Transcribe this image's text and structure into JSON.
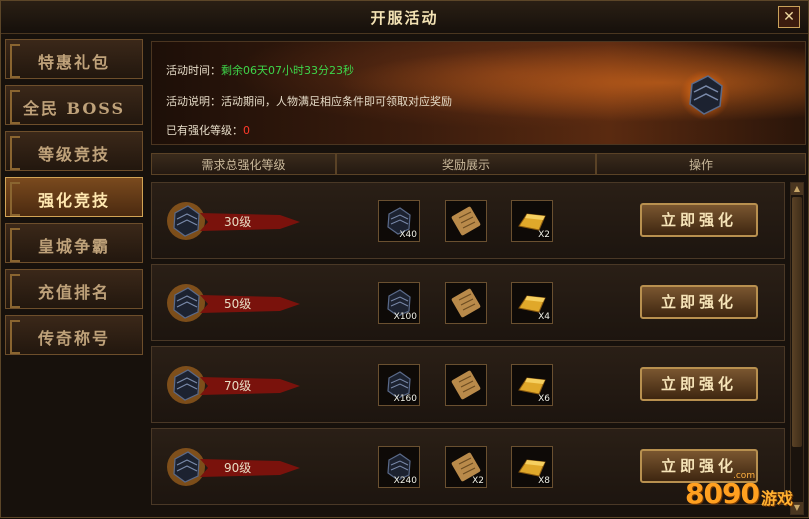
{
  "window": {
    "title": "开服活动",
    "close_symbol": "✕"
  },
  "sidebar": {
    "items": [
      {
        "label": "特惠礼包",
        "active": false
      },
      {
        "label": "全民 BOSS",
        "active": false
      },
      {
        "label": "等级竞技",
        "active": false
      },
      {
        "label": "强化竞技",
        "active": true
      },
      {
        "label": "皇城争霸",
        "active": false
      },
      {
        "label": "充值排名",
        "active": false
      },
      {
        "label": "传奇称号",
        "active": false
      }
    ]
  },
  "banner": {
    "time_label": "活动时间：",
    "time_value": "剩余06天07小时33分23秒",
    "desc_label": "活动说明：",
    "desc_value": "活动期间，人物满足相应条件即可领取对应奖励",
    "owned_label": "已有强化等级：",
    "owned_value": "0",
    "icon": "black-iron-ore-icon"
  },
  "table": {
    "headers": [
      "需求总强化等级",
      "奖励展示",
      "操作"
    ],
    "rows": [
      {
        "level": "30级",
        "rewards": [
          {
            "icon": "ore-icon",
            "qty": "X40"
          },
          {
            "icon": "scroll-icon",
            "qty": ""
          },
          {
            "icon": "gold-bar-icon",
            "qty": "X2"
          }
        ],
        "button": "立即强化"
      },
      {
        "level": "50级",
        "rewards": [
          {
            "icon": "ore-icon",
            "qty": "X100"
          },
          {
            "icon": "scroll-icon",
            "qty": ""
          },
          {
            "icon": "gold-bar-icon",
            "qty": "X4"
          }
        ],
        "button": "立即强化"
      },
      {
        "level": "70级",
        "rewards": [
          {
            "icon": "ore-icon",
            "qty": "X160"
          },
          {
            "icon": "scroll-icon",
            "qty": ""
          },
          {
            "icon": "gold-bar-icon",
            "qty": "X6"
          }
        ],
        "button": "立即强化"
      },
      {
        "level": "90级",
        "rewards": [
          {
            "icon": "ore-icon",
            "qty": "X240"
          },
          {
            "icon": "scroll-icon",
            "qty": "X2"
          },
          {
            "icon": "gold-bar-icon",
            "qty": "X8"
          }
        ],
        "button": "立即强化"
      }
    ]
  },
  "watermark": {
    "digits": "8090",
    "com": ".com",
    "text": "游戏"
  },
  "colors": {
    "timer_green": "#3ed64a",
    "level_red": "#ff3a2a",
    "gold": "#c9a15a"
  }
}
